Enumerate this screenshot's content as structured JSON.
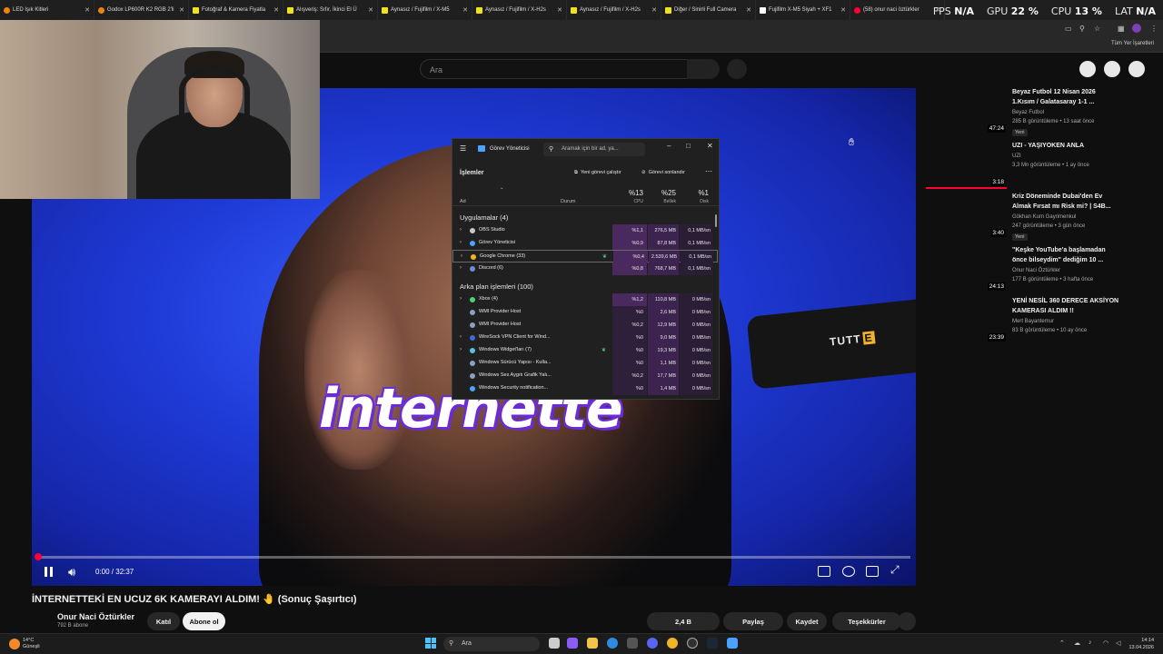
{
  "tabs": [
    {
      "title": "LED Işık Kitleri",
      "favicon": "orange"
    },
    {
      "title": "Godox LP600R K2 RGB 2'li",
      "favicon": "orange"
    },
    {
      "title": "Fotoğraf & Kamera Fiyatla",
      "favicon": "yellow"
    },
    {
      "title": "Alışveriş: Sıfır, İkinci El Ü",
      "favicon": "yellow"
    },
    {
      "title": "Aynasız / Fujifilm / X-M5",
      "favicon": "yellow"
    },
    {
      "title": "Aynasız / Fujifilm / X-H2s",
      "favicon": "yellow"
    },
    {
      "title": "Aynasız / Fujifilm / X-H2s",
      "favicon": "yellow"
    },
    {
      "title": "Diğer / Sinirli Full Camera",
      "favicon": "yellow"
    },
    {
      "title": "Fujifilm X-M5 Siyah + XF1",
      "favicon": "white"
    },
    {
      "title": "(58) onur naci öztürkler",
      "favicon": "red"
    }
  ],
  "stats": {
    "fps_label": "FPS",
    "fps": "N/A",
    "gpu_label": "GPU",
    "gpu": "22 %",
    "cpu_label": "CPU",
    "cpu": "13 %",
    "lat_label": "LAT",
    "lat": "N/A"
  },
  "bookmarks": {
    "all": "Tüm Yer İşaretleri"
  },
  "yt": {
    "search_placeholder": "Ara"
  },
  "video": {
    "caption": "internette",
    "mic_brand_a": "TUTT",
    "mic_brand_b": "E",
    "time": "0:00 / 32:37",
    "played": 0.0
  },
  "task_manager": {
    "title": "Görev Yöneticisi",
    "search_placeholder": "Aramak için bir ad, ya...",
    "section": "İşlemler",
    "run_task": "Yeni görevi çalıştır",
    "end_task": "Görevi sonlandır",
    "col_name": "Ad",
    "col_status": "Durum",
    "cpu_pct": "%13",
    "cpu_label": "CPU",
    "mem_pct": "%25",
    "mem_label": "Bellek",
    "disk_pct": "%1",
    "disk_label": "Disk",
    "apps_group": "Uygulamalar (4)",
    "bg_group": "Arka plan işlemleri (100)",
    "apps": [
      {
        "name": "OBS Studio",
        "cpu": "%1,1",
        "mem": "276,5 MB",
        "disk": "0,1 MB/sn",
        "color": "#c9c9c9",
        "expand": true,
        "leaf": false,
        "sel": false,
        "cpu_hot": true
      },
      {
        "name": "Görev Yöneticisi",
        "cpu": "%0,9",
        "mem": "87,8 MB",
        "disk": "0,1 MB/sn",
        "color": "#4aa3ff",
        "expand": true,
        "leaf": false,
        "sel": false,
        "cpu_hot": true
      },
      {
        "name": "Google Chrome (33)",
        "cpu": "%0,4",
        "mem": "2.539,6 MB",
        "disk": "0,1 MB/sn",
        "color": "#f0b429",
        "expand": true,
        "leaf": true,
        "sel": true,
        "cpu_hot": true
      },
      {
        "name": "Discord (6)",
        "cpu": "%0,8",
        "mem": "768,7 MB",
        "disk": "0,1 MB/sn",
        "color": "#7289da",
        "expand": true,
        "leaf": false,
        "sel": false,
        "cpu_hot": true
      }
    ],
    "bg": [
      {
        "name": "Xbox (4)",
        "cpu": "%1,2",
        "mem": "110,8 MB",
        "disk": "0 MB/sn",
        "color": "#4fd07a",
        "expand": true,
        "leaf": false,
        "sel": false,
        "cpu_hot": true
      },
      {
        "name": "WMI Provider Host",
        "cpu": "%0",
        "mem": "2,6 MB",
        "disk": "0 MB/sn",
        "color": "#8aa0c0",
        "expand": false,
        "leaf": false,
        "sel": false,
        "cpu_hot": false
      },
      {
        "name": "WMI Provider Host",
        "cpu": "%0,2",
        "mem": "12,9 MB",
        "disk": "0 MB/sn",
        "color": "#8aa0c0",
        "expand": false,
        "leaf": false,
        "sel": false,
        "cpu_hot": false
      },
      {
        "name": "WireSock VPN Client for Wind...",
        "cpu": "%0",
        "mem": "9,0 MB",
        "disk": "0 MB/sn",
        "color": "#3d6bd6",
        "expand": true,
        "leaf": false,
        "sel": false,
        "cpu_hot": false
      },
      {
        "name": "Windows Widget'ları (7)",
        "cpu": "%0",
        "mem": "19,3 MB",
        "disk": "0 MB/sn",
        "color": "#5bc0de",
        "expand": true,
        "leaf": true,
        "sel": false,
        "cpu_hot": false
      },
      {
        "name": "Windows Sürücü Yapısı - Kulla...",
        "cpu": "%0",
        "mem": "1,1 MB",
        "disk": "0 MB/sn",
        "color": "#8aa0c0",
        "expand": false,
        "leaf": false,
        "sel": false,
        "cpu_hot": false
      },
      {
        "name": "Windows Ses Aygıtı Grafik Yalı...",
        "cpu": "%0,2",
        "mem": "17,7 MB",
        "disk": "0 MB/sn",
        "color": "#8aa0c0",
        "expand": false,
        "leaf": false,
        "sel": false,
        "cpu_hot": false
      },
      {
        "name": "Windows Security notification...",
        "cpu": "%0",
        "mem": "1,4 MB",
        "disk": "0 MB/sn",
        "color": "#4aa3ff",
        "expand": false,
        "leaf": false,
        "sel": false,
        "cpu_hot": false
      }
    ]
  },
  "recs": [
    {
      "title": "Beyaz Futbol 12 Nisan 2026 1.Kısım / Galatasaray 1-1 ...",
      "channel": "Beyaz Futbol",
      "meta": "285 B görüntüleme • 13 saat önce",
      "badge": "Yeni",
      "duration": "47:24"
    },
    {
      "title": "UZI - YAŞIYOKEN ANLA",
      "channel": "UZI",
      "meta": "3,3 Mn görüntüleme • 1 ay önce",
      "badge": "",
      "duration": "3:18"
    },
    {
      "title": "Kriz Döneminde Dubai'den Ev Almak Fırsat mı Risk mi? | S4B...",
      "channel": "Gökhan Kum Gayrimenkul",
      "meta": "247 görüntüleme • 3 gün önce",
      "badge": "Yeni",
      "duration": "3:40"
    },
    {
      "title": "\"Keşke YouTube'a başlamadan önce bilseydim\" dediğim 10 ...",
      "channel": "Onur Naci Öztürkler",
      "meta": "177 B görüntüleme • 3 hafta önce",
      "badge": "",
      "duration": "24:13"
    },
    {
      "title": "YENİ NESİL 360 DERECE AKSİYON KAMERASI ALDIM !!",
      "channel": "Mert Bayantemur",
      "meta": "83 B görüntüleme • 10 ay önce",
      "badge": "",
      "duration": "23:39"
    }
  ],
  "below": {
    "title": "İNTERNETTEKİ EN UCUZ 6K KAMERAYI ALDIM! 🤚 (Sonuç Şaşırtıcı)",
    "channel": "Onur Naci Öztürkler",
    "subs": "792 B abone",
    "join": "Katıl",
    "subscribe": "Abone ol",
    "likes": "2,4 B",
    "share": "Paylaş",
    "save": "Kaydet",
    "thanks": "Teşekkürler"
  },
  "taskbar": {
    "temp": "14°C",
    "weather": "Güneşli",
    "search": "Ara",
    "time": "14:14",
    "date": "13.04.2026"
  }
}
